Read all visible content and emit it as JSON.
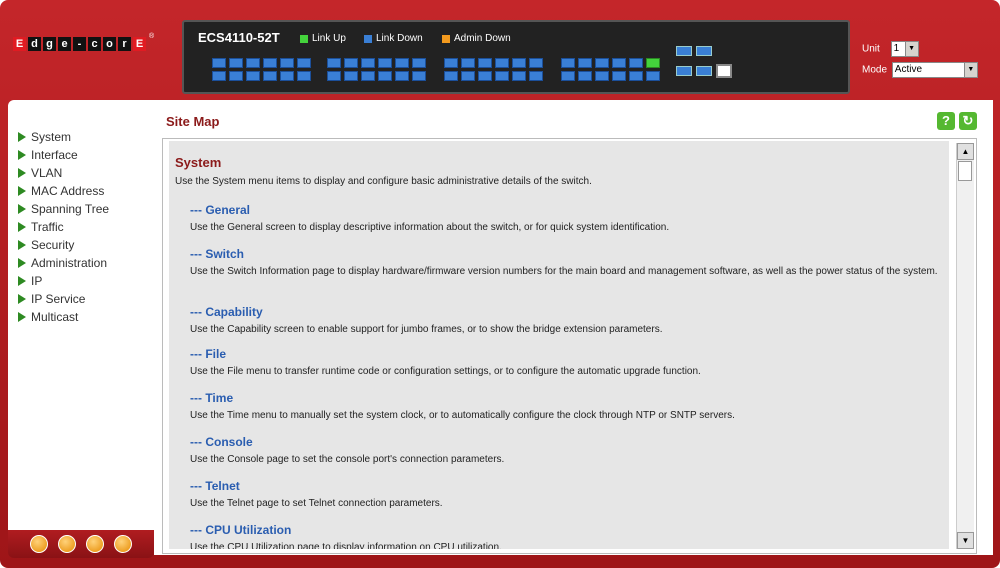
{
  "logo": {
    "letters": [
      "E",
      "d",
      "g",
      "e",
      "-",
      "c",
      "o",
      "r",
      "E"
    ],
    "reg": "®"
  },
  "device": {
    "model": "ECS4110-52T",
    "legend": [
      {
        "label": "Link Up",
        "color": "#44d33c"
      },
      {
        "label": "Link Down",
        "color": "#3a7fd5"
      },
      {
        "label": "Admin Down",
        "color": "#f39a1e"
      }
    ]
  },
  "unit": {
    "label": "Unit",
    "value": "1"
  },
  "mode": {
    "label": "Mode",
    "value": "Active"
  },
  "sidebar": {
    "items": [
      {
        "label": "System"
      },
      {
        "label": "Interface"
      },
      {
        "label": "VLAN"
      },
      {
        "label": "MAC Address"
      },
      {
        "label": "Spanning Tree"
      },
      {
        "label": "Traffic"
      },
      {
        "label": "Security"
      },
      {
        "label": "Administration"
      },
      {
        "label": "IP"
      },
      {
        "label": "IP Service"
      },
      {
        "label": "Multicast"
      }
    ]
  },
  "main": {
    "title": "Site Map",
    "help_icon": "?",
    "refresh_icon": "↻",
    "section": {
      "heading": "System",
      "desc": "Use the System menu items to display and configure basic administrative details of the switch."
    },
    "entries": [
      {
        "title": "--- General",
        "desc": "Use the General screen to display descriptive information about the switch, or for quick system identification."
      },
      {
        "title": "--- Switch",
        "desc": "Use the Switch Information page to display hardware/firmware version numbers for the main board and management software, as well as the power status of the system."
      },
      {
        "title": "--- Capability",
        "desc": "Use the Capability screen to enable support for jumbo frames, or to show the bridge extension parameters."
      },
      {
        "title": "--- File",
        "desc": "Use the File menu to transfer runtime code or configuration settings, or to configure the automatic upgrade function."
      },
      {
        "title": "--- Time",
        "desc": "Use the Time menu to manually set the system clock, or to automatically configure the clock through NTP or SNTP servers."
      },
      {
        "title": "--- Console",
        "desc": "Use the Console page to set the console port's connection parameters."
      },
      {
        "title": "--- Telnet",
        "desc": "Use the Telnet page to set Telnet connection parameters."
      },
      {
        "title": "--- CPU Utilization",
        "desc": "Use the CPU Utilization page to display information on CPU utilization."
      }
    ]
  },
  "bottom_icons": [
    "home-icon",
    "back-icon",
    "mail-icon",
    "globe-icon"
  ]
}
